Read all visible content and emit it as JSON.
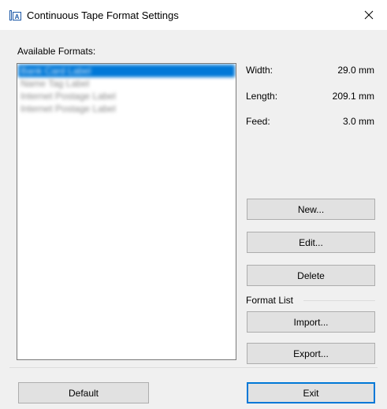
{
  "window": {
    "title": "Continuous Tape Format Settings",
    "icon": "tape-format-icon",
    "close_icon": "close-icon"
  },
  "formats": {
    "label": "Available Formats:",
    "items": [
      {
        "label": "Bank Card Label",
        "selected": true
      },
      {
        "label": "Name Tag Label",
        "selected": false
      },
      {
        "label": "Internet Postage Label",
        "selected": false
      },
      {
        "label": "Internet Postage Label",
        "selected": false
      }
    ]
  },
  "properties": {
    "width_label": "Width:",
    "width_value": "29.0 mm",
    "length_label": "Length:",
    "length_value": "209.1 mm",
    "feed_label": "Feed:",
    "feed_value": "3.0 mm"
  },
  "buttons": {
    "new": "New...",
    "edit": "Edit...",
    "delete": "Delete",
    "import": "Import...",
    "export": "Export...",
    "default": "Default",
    "exit": "Exit"
  },
  "format_list": {
    "label": "Format List"
  },
  "colors": {
    "selection": "#0078d7",
    "focus_border": "#0078d7",
    "background": "#f0f0f0"
  }
}
